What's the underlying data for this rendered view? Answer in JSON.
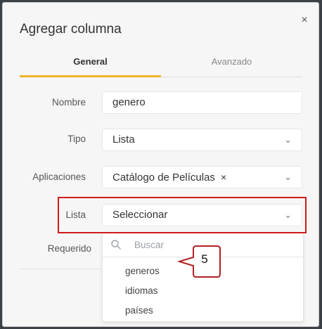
{
  "dialog": {
    "title": "Agregar columna",
    "close_glyph": "×"
  },
  "tabs": [
    {
      "label": "General",
      "active": true
    },
    {
      "label": "Avanzado",
      "active": false
    }
  ],
  "fields": {
    "nombre": {
      "label": "Nombre",
      "value": "genero"
    },
    "tipo": {
      "label": "Tipo",
      "value": "Lista"
    },
    "aplicaciones": {
      "label": "Aplicaciones",
      "tag": "Catálogo de Películas",
      "tag_remove": "×"
    },
    "lista": {
      "label": "Lista",
      "value": "Seleccionar"
    },
    "requerido": {
      "label": "Requerido"
    }
  },
  "dropdown": {
    "search_placeholder": "Buscar",
    "options": [
      "generos",
      "idiomas",
      "países"
    ]
  },
  "callout": {
    "text": "5"
  },
  "colors": {
    "accent": "#f0b429",
    "highlight": "#d11a1a"
  },
  "icons": {
    "chevron": "chevron-down-icon",
    "search": "search-icon",
    "close": "close-icon"
  }
}
